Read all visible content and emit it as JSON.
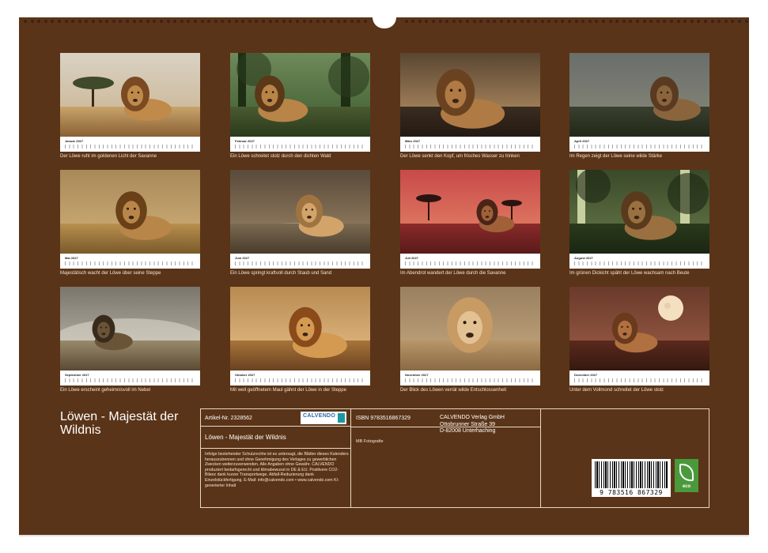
{
  "product": {
    "title": "Löwen - Majestät der Wildnis",
    "article_number": "Artikel-Nr. 2328562",
    "isbn": "ISBN 9783516867329",
    "photographer": "MB Fotografie",
    "barcode_digits": "9 783516 867329",
    "eco_label": "eco"
  },
  "publisher": {
    "logo_text": "CALVENDO",
    "address_line_1": "CALVENDO Verlag GmbH",
    "address_line_2": "Ottobrunner Straße 39",
    "address_line_3": "D-82008 Unterhaching"
  },
  "legal_text": "Infolge bestehender Schutzrechte ist es untersagt, die Blätter dieses Kalenders herauszutrennen und ohne Genehmigung des Verlages zu gewerblichen Zwecken weiterzuverwenden. Alle Angaben ohne Gewähr. CALVENDO produziert bedarfsgerecht und klimabewusst in DE & EU. Positivere CO2-Bilanz dank kurzer Transportwege. Abfall-Reduzierung dank Einzelstückfertigung. E-Mail: info@calvendo.com • www.calvendo.com KI-generierter Inhalt",
  "months": [
    {
      "name": "Januar 2027",
      "caption": "Der Löwe ruht im goldenen Licht der Savanne"
    },
    {
      "name": "Februar 2027",
      "caption": "Ein Löwe schreitet stolz durch den dichten Wald"
    },
    {
      "name": "März 2027",
      "caption": "Der Löwe senkt den Kopf, um frisches Wasser zu trinken"
    },
    {
      "name": "April 2027",
      "caption": "Im Regen zeigt der Löwe seine wilde Stärke"
    },
    {
      "name": "Mai 2027",
      "caption": "Majestätisch wacht der Löwe über seine Steppe"
    },
    {
      "name": "Juni 2027",
      "caption": "Ein Löwe springt kraftvoll durch Staub und Sand"
    },
    {
      "name": "Juli 2027",
      "caption": "Im Abendrot wandert der Löwe durch die Savanne"
    },
    {
      "name": "August 2027",
      "caption": "Im grünen Dickicht späht der Löwe wachsam nach Beute"
    },
    {
      "name": "September 2027",
      "caption": "Ein Löwe erscheint geheimnisvoll im Nebel"
    },
    {
      "name": "Oktober 2027",
      "caption": "Mit weit geöffnetem Maul gähnt der Löwe in der Steppe"
    },
    {
      "name": "November 2027",
      "caption": "Der Blick des Löwen verrät wilde Entschlossenheit"
    },
    {
      "name": "Dezember 2027",
      "caption": "Unter dem Vollmond schreitet der Löwe stolz"
    }
  ]
}
